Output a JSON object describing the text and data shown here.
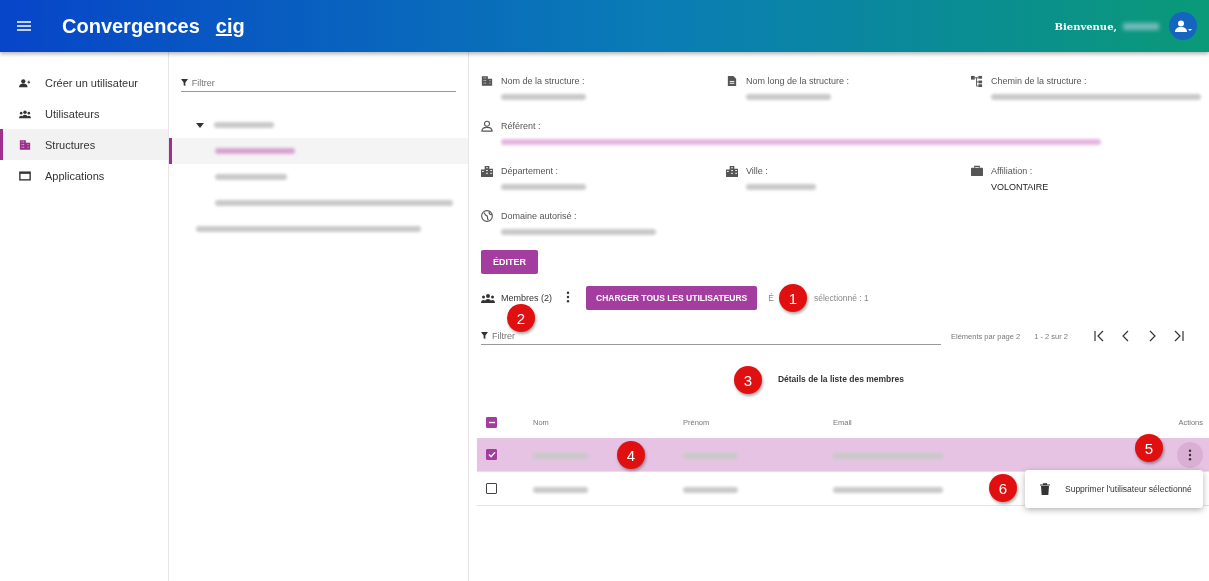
{
  "header": {
    "app_name": "Convergences",
    "logo_text": "cig",
    "welcome": "Bienvenue,"
  },
  "sidebar": {
    "items": [
      {
        "label": "Créer un utilisateur",
        "selected": false
      },
      {
        "label": "Utilisateurs",
        "selected": false
      },
      {
        "label": "Structures",
        "selected": true
      },
      {
        "label": "Applications",
        "selected": false
      }
    ]
  },
  "tree": {
    "filter_placeholder": "Filtrer",
    "nodes": [
      {
        "expanded": true,
        "selected": false,
        "children": [
          {
            "selected": true
          },
          {
            "selected": false
          },
          {
            "selected": false
          }
        ]
      },
      {
        "selected": false
      }
    ]
  },
  "details": {
    "fields": [
      {
        "label": "Nom de la structure :"
      },
      {
        "label": "Nom long de la structure :"
      },
      {
        "label": "Chemin de la structure :"
      },
      {
        "label": "Référent :"
      },
      {
        "label": "Département :"
      },
      {
        "label": "Ville :"
      },
      {
        "label": "Affiliation :",
        "value": "VOLONTAIRE"
      },
      {
        "label": "Domaine autorisé :"
      }
    ],
    "edit_button": "ÉDITER"
  },
  "members": {
    "label": "Membres (2)",
    "load_button": "CHARGER TOUS LES UTILISATEURS",
    "selected_prefix": "É",
    "selected_text": "sélectionné : 1",
    "filter_placeholder": "Filtrer",
    "per_page_label": "Eléments par page",
    "per_page": "2",
    "range": "1 - 2 sur 2",
    "title": "Détails de la liste des membres"
  },
  "table": {
    "select_all_indeterminate": true,
    "columns": [
      "Nom",
      "Prénom",
      "Email",
      "Actions"
    ],
    "rows": [
      {
        "checked": true,
        "selected": true
      },
      {
        "checked": false,
        "selected": false
      }
    ]
  },
  "row_menu": {
    "items": [
      "Supprimer l'utilisateur sélectionné"
    ]
  },
  "annotations": [
    "1",
    "2",
    "3",
    "4",
    "5",
    "6"
  ]
}
